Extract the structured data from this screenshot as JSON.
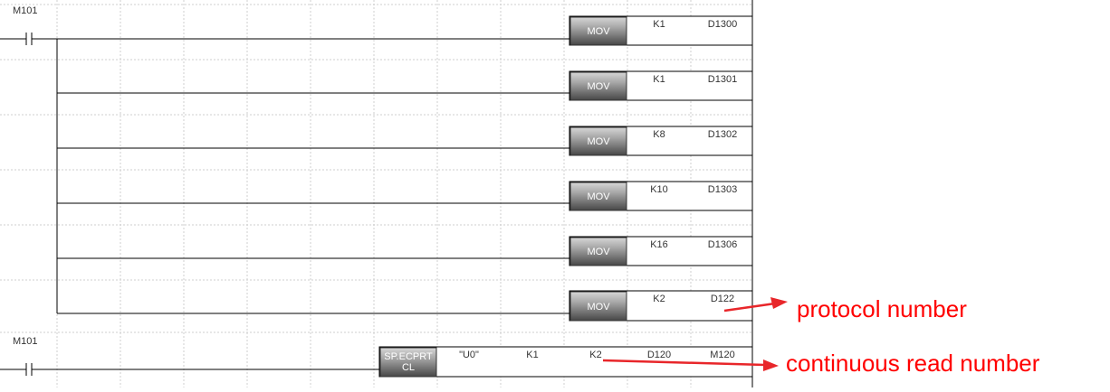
{
  "rungs": [
    {
      "contact": "M101",
      "rows": [
        {
          "instruction": "MOV",
          "operands": [
            "K1",
            "D1300"
          ]
        },
        {
          "instruction": "MOV",
          "operands": [
            "K1",
            "D1301"
          ]
        },
        {
          "instruction": "MOV",
          "operands": [
            "K8",
            "D1302"
          ]
        },
        {
          "instruction": "MOV",
          "operands": [
            "K10",
            "D1303"
          ]
        },
        {
          "instruction": "MOV",
          "operands": [
            "K16",
            "D1306"
          ]
        },
        {
          "instruction": "MOV",
          "operands": [
            "K2",
            "D122"
          ]
        }
      ]
    },
    {
      "contact": "M101",
      "instruction_lines": [
        "SP.ECPRT",
        "CL"
      ],
      "operands": [
        "\"U0\"",
        "K1",
        "K2",
        "D120",
        "M120"
      ]
    }
  ],
  "annotations": {
    "protocol": "protocol number",
    "continuous": "continuous read number"
  },
  "colors": {
    "instruction_button_top": "#c8c8c8",
    "instruction_button_bottom": "#4e4e4e",
    "arrow": "#e8262a",
    "annotation_text": "#ff0000"
  }
}
